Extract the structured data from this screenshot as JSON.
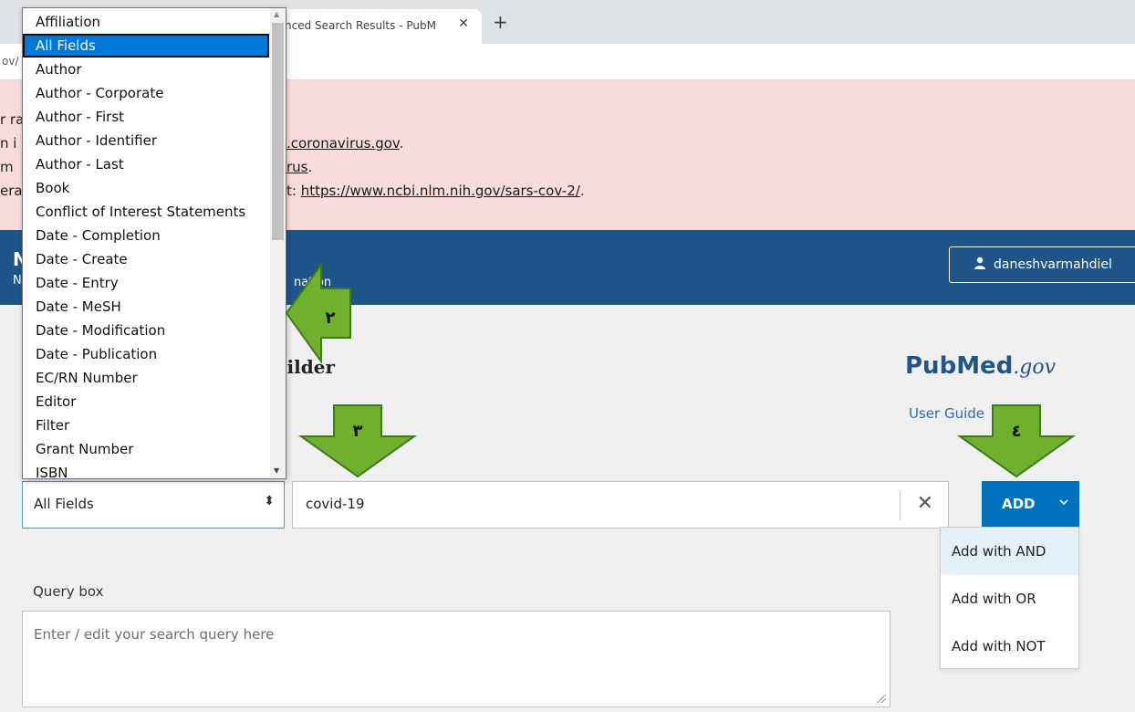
{
  "browser": {
    "tab_title": "nced Search Results - PubM",
    "tab_close": "✕",
    "new_tab": "+",
    "url_fragment": "ov/"
  },
  "alert": {
    "lines": [
      {
        "pre": "r ra",
        "link": "",
        "post": ""
      },
      {
        "pre": "n i",
        "link": "",
        "post": ""
      },
      {
        "pre": "m",
        "link": "",
        "post": ""
      },
      {
        "pre": "era",
        "link": "",
        "post": ""
      }
    ],
    "fragment_1": ".coronavirus.gov",
    "fragment_1_end": ".",
    "fragment_2": "rus",
    "fragment_2_end": ".",
    "fragment_3_pre": "t: ",
    "fragment_3_link": "https://www.ncbi.nlm.nih.gov/sars-cov-2/",
    "fragment_3_end": "."
  },
  "header": {
    "brand_letter": "N",
    "brand_sub": "N",
    "link_fragment": "nation",
    "user_icon": "👤",
    "user_name": "daneshvarmahdiel"
  },
  "main": {
    "title_fragment": "uilder",
    "logo_pub": "Pub",
    "logo_med": "Med",
    "logo_gov": ".gov",
    "user_guide": "User Guide",
    "field_value": "All Fields",
    "field_arrows": "⬍",
    "term_value": "covid-19",
    "clear_glyph": "✕",
    "add_label": "ADD",
    "add_chevron": "⌄",
    "add_menu": [
      "Add with AND",
      "Add with OR",
      "Add with NOT"
    ],
    "query_label": "Query box",
    "query_placeholder": "Enter / edit your search query here"
  },
  "dropdown": {
    "options": [
      "Affiliation",
      "All Fields",
      "Author",
      "Author - Corporate",
      "Author - First",
      "Author - Identifier",
      "Author - Last",
      "Book",
      "Conflict of Interest Statements",
      "Date - Completion",
      "Date - Create",
      "Date - Entry",
      "Date - MeSH",
      "Date - Modification",
      "Date - Publication",
      "EC/RN Number",
      "Editor",
      "Filter",
      "Grant Number",
      "ISBN"
    ],
    "selected": "All Fields",
    "scroll_up": "▲",
    "scroll_down": "▼"
  },
  "annotations": [
    {
      "label": "٢"
    },
    {
      "label": "٣"
    },
    {
      "label": "٤"
    }
  ],
  "colors": {
    "header_bg": "#20558a",
    "alert_bg": "#f8dcdc",
    "add_btn": "#0071bc",
    "arrow_fill": "#6fb02e",
    "selected_option": "#0078d7"
  }
}
